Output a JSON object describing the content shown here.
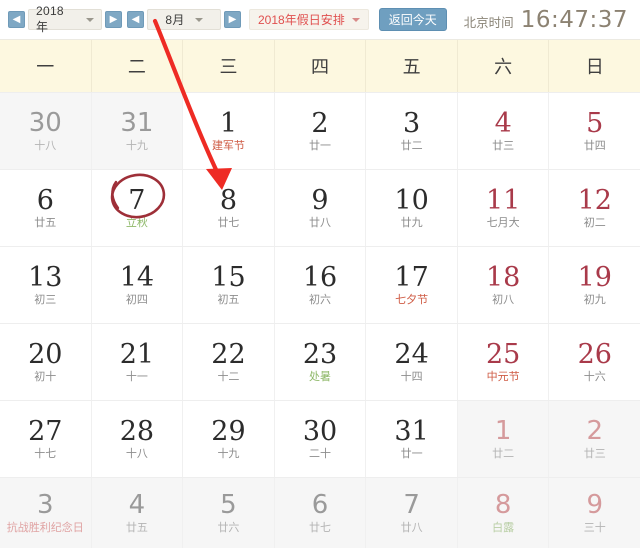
{
  "toolbar": {
    "prev_year_icon": "chevron-left-icon",
    "next_year_icon": "chevron-right-icon",
    "prev_month_icon": "chevron-left-icon",
    "next_month_icon": "chevron-right-icon",
    "year_value": "2018年",
    "month_value": "8月",
    "holiday_label": "2018年假日安排",
    "today_label": "返回今天",
    "clock_label": "北京时间",
    "clock_time": "16:47:37",
    "accent_blue": "#6f9fc0",
    "accent_red": "#e0504f"
  },
  "weekdays": [
    "一",
    "二",
    "三",
    "四",
    "五",
    "六",
    "日"
  ],
  "weeks": [
    [
      {
        "num": "30",
        "sub": "十八",
        "sub_type": "lunar",
        "out": true,
        "weekend": false
      },
      {
        "num": "31",
        "sub": "十九",
        "sub_type": "lunar",
        "out": true,
        "weekend": false
      },
      {
        "num": "1",
        "sub": "建军节",
        "sub_type": "fest",
        "out": false,
        "weekend": false
      },
      {
        "num": "2",
        "sub": "廿一",
        "sub_type": "lunar",
        "out": false,
        "weekend": false
      },
      {
        "num": "3",
        "sub": "廿二",
        "sub_type": "lunar",
        "out": false,
        "weekend": false
      },
      {
        "num": "4",
        "sub": "廿三",
        "sub_type": "lunar",
        "out": false,
        "weekend": true
      },
      {
        "num": "5",
        "sub": "廿四",
        "sub_type": "lunar",
        "out": false,
        "weekend": true
      }
    ],
    [
      {
        "num": "6",
        "sub": "廿五",
        "sub_type": "lunar",
        "out": false,
        "weekend": false
      },
      {
        "num": "7",
        "sub": "立秋",
        "sub_type": "term",
        "out": false,
        "weekend": false,
        "circled": true
      },
      {
        "num": "8",
        "sub": "廿七",
        "sub_type": "lunar",
        "out": false,
        "weekend": false,
        "arrow_target": true
      },
      {
        "num": "9",
        "sub": "廿八",
        "sub_type": "lunar",
        "out": false,
        "weekend": false
      },
      {
        "num": "10",
        "sub": "廿九",
        "sub_type": "lunar",
        "out": false,
        "weekend": false
      },
      {
        "num": "11",
        "sub": "七月大",
        "sub_type": "lunar",
        "out": false,
        "weekend": true
      },
      {
        "num": "12",
        "sub": "初二",
        "sub_type": "lunar",
        "out": false,
        "weekend": true
      }
    ],
    [
      {
        "num": "13",
        "sub": "初三",
        "sub_type": "lunar",
        "out": false,
        "weekend": false
      },
      {
        "num": "14",
        "sub": "初四",
        "sub_type": "lunar",
        "out": false,
        "weekend": false
      },
      {
        "num": "15",
        "sub": "初五",
        "sub_type": "lunar",
        "out": false,
        "weekend": false
      },
      {
        "num": "16",
        "sub": "初六",
        "sub_type": "lunar",
        "out": false,
        "weekend": false
      },
      {
        "num": "17",
        "sub": "七夕节",
        "sub_type": "fest",
        "out": false,
        "weekend": false
      },
      {
        "num": "18",
        "sub": "初八",
        "sub_type": "lunar",
        "out": false,
        "weekend": true
      },
      {
        "num": "19",
        "sub": "初九",
        "sub_type": "lunar",
        "out": false,
        "weekend": true
      }
    ],
    [
      {
        "num": "20",
        "sub": "初十",
        "sub_type": "lunar",
        "out": false,
        "weekend": false
      },
      {
        "num": "21",
        "sub": "十一",
        "sub_type": "lunar",
        "out": false,
        "weekend": false
      },
      {
        "num": "22",
        "sub": "十二",
        "sub_type": "lunar",
        "out": false,
        "weekend": false
      },
      {
        "num": "23",
        "sub": "处暑",
        "sub_type": "term",
        "out": false,
        "weekend": false
      },
      {
        "num": "24",
        "sub": "十四",
        "sub_type": "lunar",
        "out": false,
        "weekend": false
      },
      {
        "num": "25",
        "sub": "中元节",
        "sub_type": "fest",
        "out": false,
        "weekend": true
      },
      {
        "num": "26",
        "sub": "十六",
        "sub_type": "lunar",
        "out": false,
        "weekend": true
      }
    ],
    [
      {
        "num": "27",
        "sub": "十七",
        "sub_type": "lunar",
        "out": false,
        "weekend": false
      },
      {
        "num": "28",
        "sub": "十八",
        "sub_type": "lunar",
        "out": false,
        "weekend": false
      },
      {
        "num": "29",
        "sub": "十九",
        "sub_type": "lunar",
        "out": false,
        "weekend": false
      },
      {
        "num": "30",
        "sub": "二十",
        "sub_type": "lunar",
        "out": false,
        "weekend": false
      },
      {
        "num": "31",
        "sub": "廿一",
        "sub_type": "lunar",
        "out": false,
        "weekend": false
      },
      {
        "num": "1",
        "sub": "廿二",
        "sub_type": "lunar",
        "out": true,
        "weekend": true
      },
      {
        "num": "2",
        "sub": "廿三",
        "sub_type": "lunar",
        "out": true,
        "weekend": true
      }
    ],
    [
      {
        "num": "3",
        "sub": "抗战胜利纪念日",
        "sub_type": "fest",
        "out": true,
        "weekend": false
      },
      {
        "num": "4",
        "sub": "廿五",
        "sub_type": "lunar",
        "out": true,
        "weekend": false
      },
      {
        "num": "5",
        "sub": "廿六",
        "sub_type": "lunar",
        "out": true,
        "weekend": false
      },
      {
        "num": "6",
        "sub": "廿七",
        "sub_type": "lunar",
        "out": true,
        "weekend": false
      },
      {
        "num": "7",
        "sub": "廿八",
        "sub_type": "lunar",
        "out": true,
        "weekend": false
      },
      {
        "num": "8",
        "sub": "白露",
        "sub_type": "term",
        "out": true,
        "weekend": true
      },
      {
        "num": "9",
        "sub": "三十",
        "sub_type": "lunar",
        "out": true,
        "weekend": true
      }
    ]
  ],
  "annotations": {
    "arrow_color": "#ee2b24",
    "circle_color": "#9e2f38"
  }
}
